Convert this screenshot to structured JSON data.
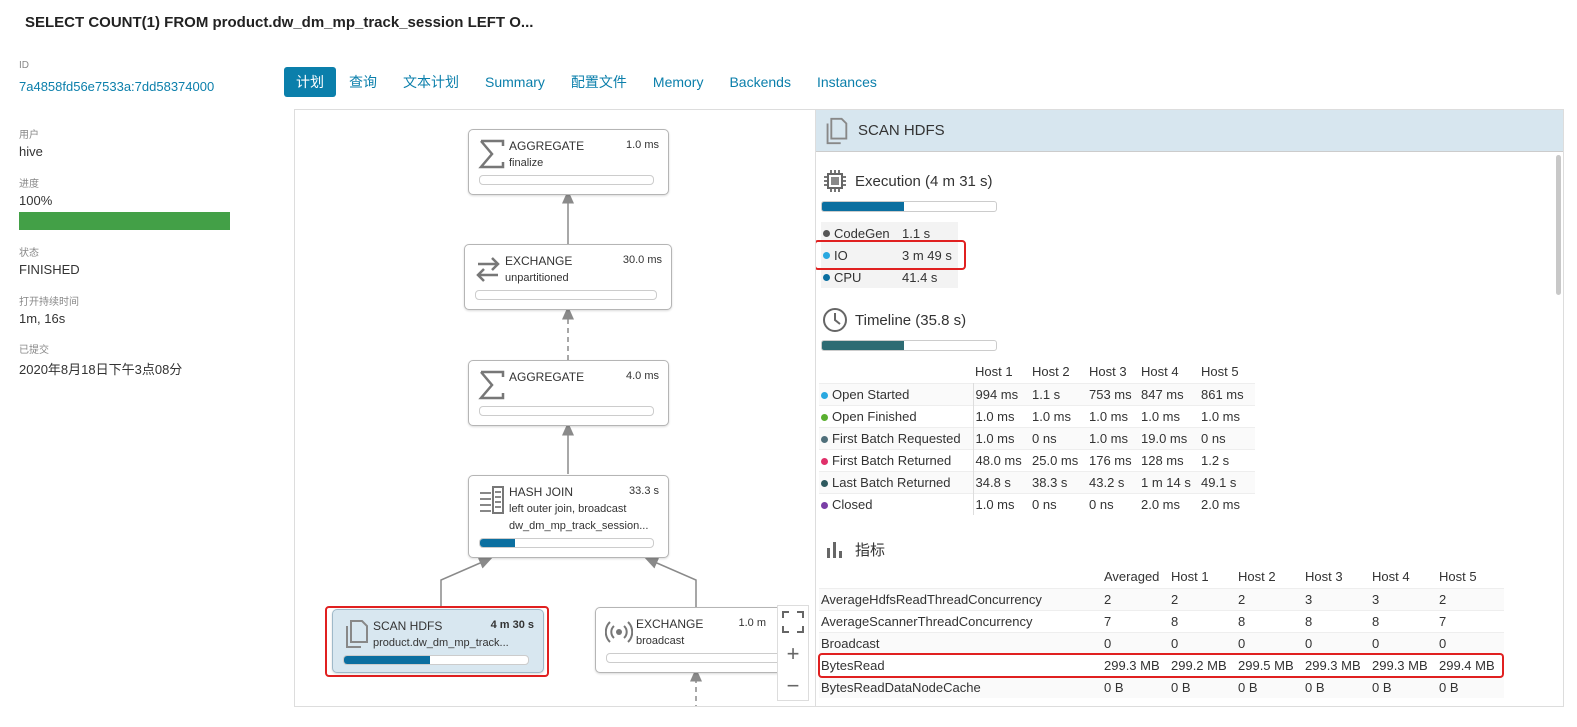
{
  "title": "SELECT COUNT(1) FROM product.dw_dm_mp_track_session LEFT O...",
  "meta": [
    {
      "label": "ID",
      "value": "7a4858fd56e7533a:7dd58374000"
    },
    {
      "label": "用户",
      "value": "hive"
    },
    {
      "label": "进度",
      "value": "100%"
    },
    {
      "label": "状态",
      "value": "FINISHED"
    },
    {
      "label": "打开持续时间",
      "value": "1m, 16s"
    },
    {
      "label": "已提交",
      "value": "2020年8月18日下午3点08分"
    }
  ],
  "progress": 1.0,
  "tabs": [
    "计划",
    "查询",
    "文本计划",
    "Summary",
    "配置文件",
    "Memory",
    "Backends",
    "Instances"
  ],
  "active_tab": "计划",
  "graph": {
    "nodes": [
      {
        "name": "AGGREGATE",
        "time": "1.0 ms",
        "sub": [
          "finalize"
        ],
        "icon": "sigma-icon",
        "progress": 0
      },
      {
        "name": "EXCHANGE",
        "time": "30.0 ms",
        "sub": [
          "unpartitioned"
        ],
        "icon": "exchange-arrows-icon",
        "progress": 0
      },
      {
        "name": "AGGREGATE",
        "time": "4.0 ms",
        "sub": [],
        "icon": "sigma-icon",
        "progress": 0
      },
      {
        "name": "HASH JOIN",
        "time": "33.3 s",
        "sub": [
          "left outer join, broadcast",
          "dw_dm_mp_track_session..."
        ],
        "icon": "hash-join-icon",
        "progress": 0.2
      },
      {
        "name": "SCAN HDFS",
        "time": "4 m 30 s",
        "sub": [
          "product.dw_dm_mp_track..."
        ],
        "icon": "copy-files-icon",
        "progress": 0.47,
        "selected": true
      },
      {
        "name": "EXCHANGE",
        "time": "1.0 m",
        "sub": [
          "broadcast"
        ],
        "icon": "broadcast-icon",
        "progress": 0
      }
    ],
    "zoom_controls": [
      "fit",
      "+",
      "−"
    ]
  },
  "panel": {
    "title": "SCAN HDFS",
    "execution": {
      "title": "Execution (4 m 31 s)",
      "bar_fraction": 0.47,
      "bar_color": "#0b6fa0",
      "rows": [
        {
          "key": "CodeGen",
          "value": "1.1 s",
          "color": "#555555"
        },
        {
          "key": "IO",
          "value": "3 m 49 s",
          "color": "#29a8e0",
          "highlighted": true
        },
        {
          "key": "CPU",
          "value": "41.4 s",
          "color": "#0b6fa0"
        }
      ]
    },
    "timeline": {
      "title": "Timeline (35.8 s)",
      "bar_fraction": 0.47,
      "bar_color": "#2e6b73",
      "headers": [
        "Host 1",
        "Host 2",
        "Host 3",
        "Host 4",
        "Host 5"
      ],
      "rows": [
        {
          "label": "Open Started",
          "color": "#29a8e0",
          "values": [
            "994 ms",
            "1.1 s",
            "753 ms",
            "847 ms",
            "861 ms"
          ]
        },
        {
          "label": "Open Finished",
          "color": "#5ab030",
          "values": [
            "1.0 ms",
            "1.0 ms",
            "1.0 ms",
            "1.0 ms",
            "1.0 ms"
          ]
        },
        {
          "label": "First Batch Requested",
          "color": "#4f6f7a",
          "values": [
            "1.0 ms",
            "0 ns",
            "1.0 ms",
            "19.0 ms",
            "0 ns"
          ]
        },
        {
          "label": "First Batch Returned",
          "color": "#e0306a",
          "values": [
            "48.0 ms",
            "25.0 ms",
            "176 ms",
            "128 ms",
            "1.2 s"
          ]
        },
        {
          "label": "Last Batch Returned",
          "color": "#2e5a5f",
          "values": [
            "34.8 s",
            "38.3 s",
            "43.2 s",
            "1 m 14 s",
            "49.1 s"
          ]
        },
        {
          "label": "Closed",
          "color": "#7a3fa6",
          "values": [
            "1.0 ms",
            "0 ns",
            "0 ns",
            "2.0 ms",
            "2.0 ms"
          ]
        }
      ]
    },
    "metrics": {
      "title": "指标",
      "headers": [
        "Averaged",
        "Host 1",
        "Host 2",
        "Host 3",
        "Host 4",
        "Host 5"
      ],
      "rows": [
        {
          "label": "AverageHdfsReadThreadConcurrency",
          "values": [
            "2",
            "2",
            "2",
            "3",
            "3",
            "2"
          ]
        },
        {
          "label": "AverageScannerThreadConcurrency",
          "values": [
            "7",
            "8",
            "8",
            "8",
            "8",
            "7"
          ]
        },
        {
          "label": "Broadcast",
          "values": [
            "0",
            "0",
            "0",
            "0",
            "0",
            "0"
          ]
        },
        {
          "label": "BytesRead",
          "values": [
            "299.3 MB",
            "299.2 MB",
            "299.5 MB",
            "299.3 MB",
            "299.3 MB",
            "299.4 MB"
          ],
          "highlighted": true
        },
        {
          "label": "BytesReadDataNodeCache",
          "values": [
            "0 B",
            "0 B",
            "0 B",
            "0 B",
            "0 B",
            "0 B"
          ]
        }
      ]
    }
  }
}
